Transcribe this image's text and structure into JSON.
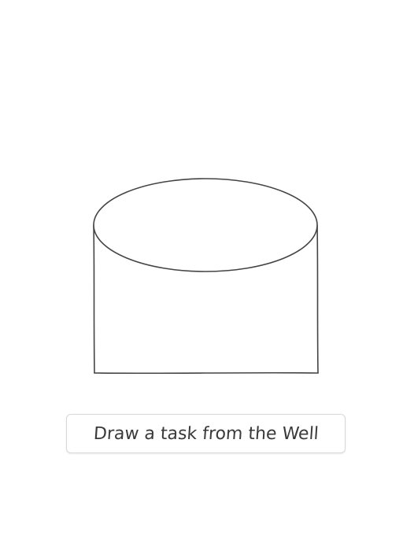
{
  "well": {
    "icon": "well-icon",
    "stroke_color": "#444444",
    "fill_color": "#ffffff"
  },
  "actions": {
    "draw_task_label": "Draw a task from the Well"
  }
}
